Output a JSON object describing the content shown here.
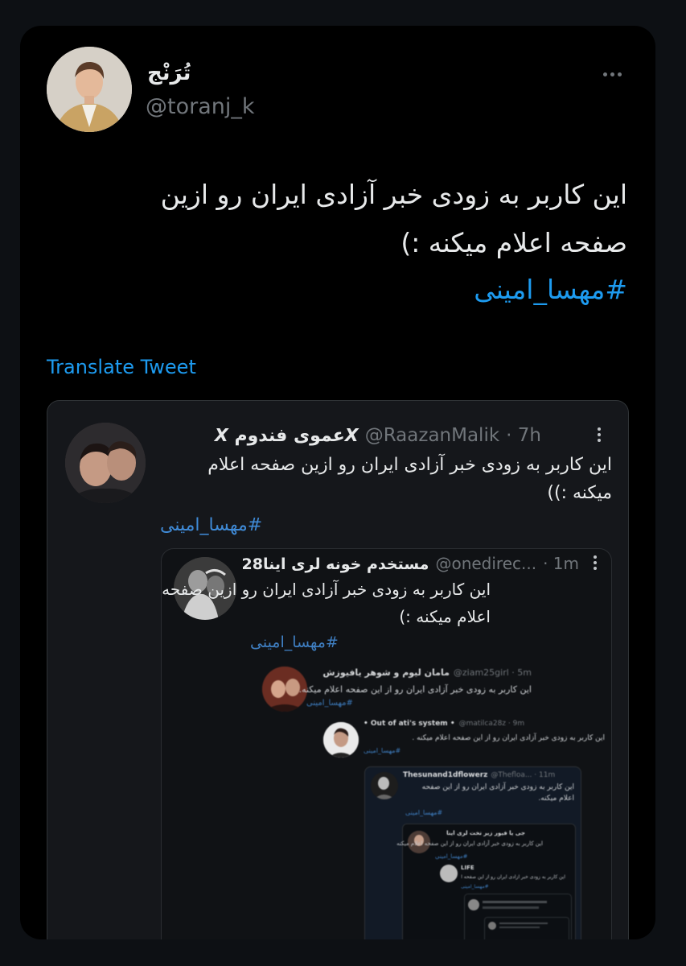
{
  "tweet": {
    "display_name": "تُرَنْج",
    "handle": "@toranj_k",
    "text_line1": "این کاربر به زودی خبر آزادی ایران رو ازین",
    "text_line2": "صفحه اعلام میکنه :)",
    "hashtag": "#مهسا_امینی",
    "translate": "Translate Tweet"
  },
  "quote1": {
    "display_name": "𝙓عموی فندوم 𝙓",
    "handle": "@RaazanMalik",
    "time": "· 7h",
    "text_line1": "این کاربر به زودی خبر آزادی ایران رو ازین صفحه اعلام",
    "text_line2": "میکنه :))",
    "hashtag": "#مهسا_امینی"
  },
  "quote2": {
    "display_name": "مستخدم خونه لری اینا28",
    "handle": "@onedirec...",
    "time": "· 1m",
    "text_line1": "این کاربر به زودی خبر آزادی ایران رو ازین صفحه",
    "text_line2": "اعلام میکنه :)",
    "hashtag": "#مهسا_امینی"
  },
  "quote3": {
    "display_name": "مامان لیوم و شوهر یافیوزش",
    "handle": "@ziam25girl · 5m",
    "text": "این کاربر به زودی خبر آزادی ایران رو از این صفحه اعلام میکنه.",
    "hashtag": "#مهسا_امینی"
  },
  "quote4": {
    "display_name": "• Out of ati's system •",
    "handle": "@matilca28z · 9m",
    "text": "این کاربر به زودی خبر آزادی ایران رو از این صفحه اعلام میکنه .",
    "hashtag": "#مهسا_امینی"
  },
  "quote5": {
    "display_name": "Thesunand1dflowerz",
    "handle": "@Thefloa... · 11m",
    "text_line1": "این کاربر به زودی خبر آزادی ایران رو از این صفحه",
    "text_line2": "اعلام میکنه.",
    "hashtag": "#مهسا_امینی"
  },
  "quote6": {
    "display_name": "جی یا فیور زیر تخت لری اینا",
    "text": "این کاربر به زودی خبر آزادی ایران رو از این صفحه اعلام میکنه",
    "hashtag": "#مهسا_امینی"
  },
  "quote7": {
    "display_name": "LIFE",
    "text": "این کاربر به زودی خبر آزادی ایران رو از این صفحه اعلام میکنه",
    "hashtag": "#مهسا_امینی"
  },
  "colors": {
    "link": "#1d9bf0",
    "muted": "#71767b",
    "background": "#000000"
  }
}
